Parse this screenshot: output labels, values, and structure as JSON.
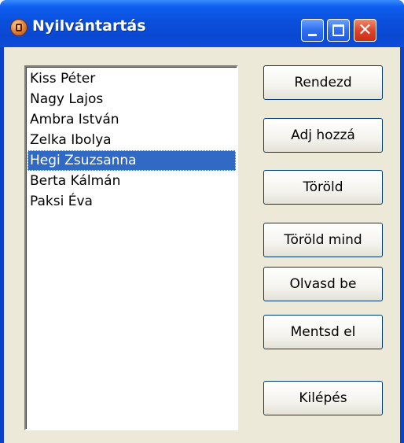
{
  "window": {
    "title": "Nyilvántartás"
  },
  "list": {
    "items": [
      "Kiss Péter",
      "Nagy Lajos",
      "Ambra István",
      "Zelka Ibolya",
      "Hegi Zsuzsanna",
      "Berta Kálmán",
      "Paksi Éva"
    ],
    "selected": "Hegi Zsuzsanna"
  },
  "buttons": {
    "sort": "Rendezd",
    "add": "Adj hozzá",
    "delete": "Töröld",
    "delete_all": "Töröld mind",
    "load": "Olvasd be",
    "save": "Mentsd el",
    "exit": "Kilépés"
  },
  "icons": {
    "app": "app-icon",
    "minimize": "minimize-icon",
    "maximize": "maximize-icon",
    "close": "close-icon"
  },
  "colors": {
    "titlebar": "#0a4fdc",
    "selection": "#316ac5",
    "client_bg": "#ece9d8",
    "close_button": "#e0442a"
  }
}
